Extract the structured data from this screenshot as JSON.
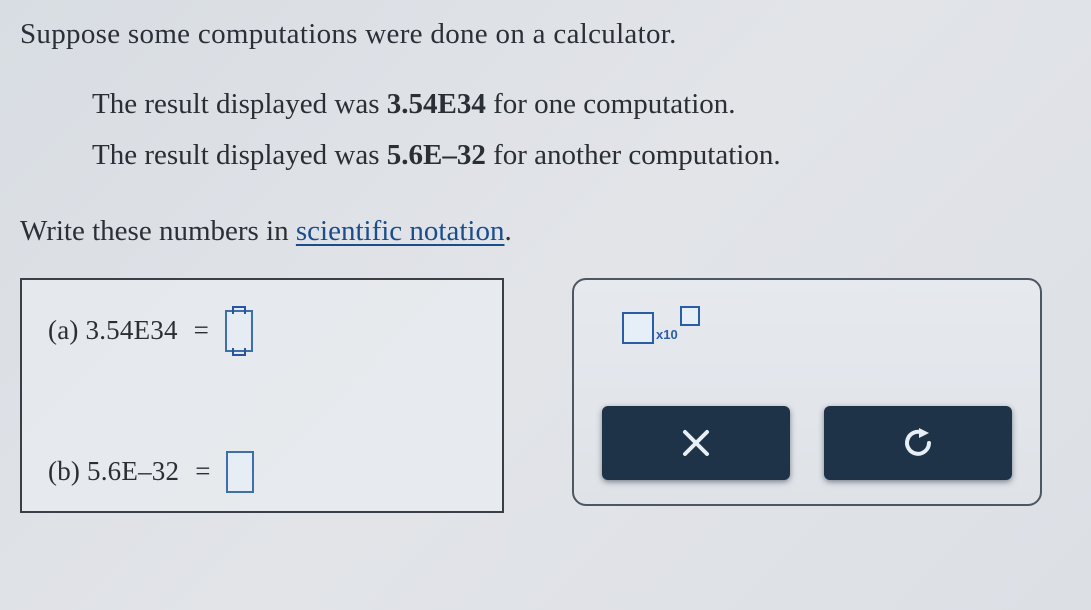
{
  "intro": "Suppose some computations were done on a calculator.",
  "results": {
    "line1_pre": "The result displayed was ",
    "line1_val": "3.54E34",
    "line1_post": " for one computation.",
    "line2_pre": "The result displayed was ",
    "line2_val": "5.6E–32",
    "line2_post": " for another computation."
  },
  "prompt_pre": "Write these numbers in ",
  "prompt_link": "scientific notation",
  "prompt_post": ".",
  "answers": {
    "a": {
      "label": "(a) 3.54E34",
      "equals": "="
    },
    "b": {
      "label": "(b) 5.6E–32",
      "equals": "="
    }
  },
  "palette": {
    "x10": "x10"
  }
}
